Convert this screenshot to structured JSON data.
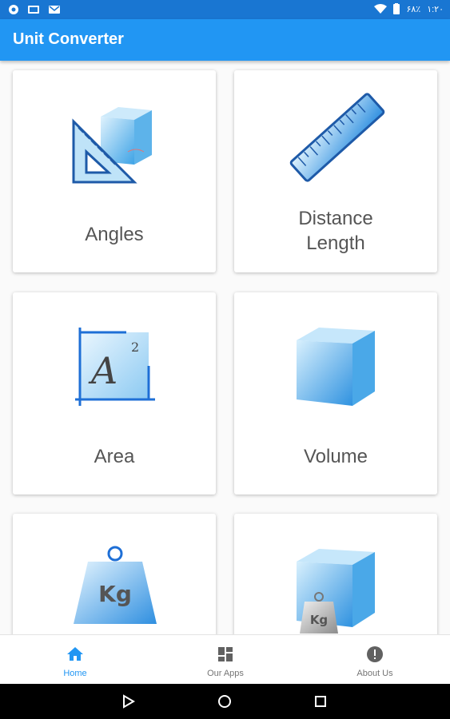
{
  "status_bar": {
    "battery": "۶۸٪",
    "time": "۱:۲۰"
  },
  "app": {
    "title": "Unit Converter"
  },
  "cards": [
    {
      "label": "Angles",
      "icon": "angles-icon"
    },
    {
      "label": "Distance\nLength",
      "line1": "Distance",
      "line2": "Length",
      "icon": "ruler-icon"
    },
    {
      "label": "Area",
      "icon": "area-icon"
    },
    {
      "label": "Volume",
      "icon": "cube-icon"
    },
    {
      "label": "",
      "icon": "weight-kg-icon",
      "icon_text": "Kg"
    },
    {
      "label": "",
      "icon": "cube-weight-icon",
      "icon_text": "Kg"
    }
  ],
  "bottom_nav": [
    {
      "label": "Home",
      "icon": "home-icon",
      "active": true
    },
    {
      "label": "Our Apps",
      "icon": "apps-grid-icon",
      "active": false
    },
    {
      "label": "About Us",
      "icon": "info-icon",
      "active": false
    }
  ],
  "colors": {
    "primary": "#2196f3",
    "status_bar": "#1976d2",
    "label": "#555555",
    "inactive": "#757575"
  }
}
